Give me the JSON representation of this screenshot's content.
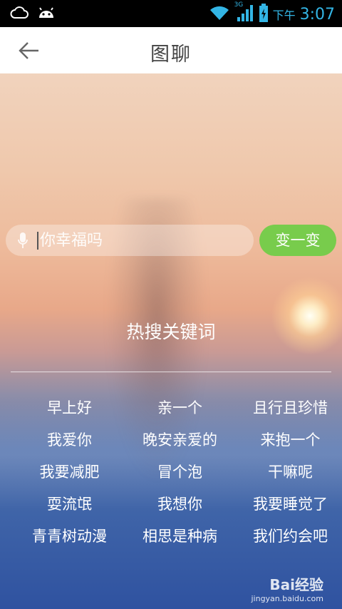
{
  "status_bar": {
    "ampm": "下午",
    "time": "3:07",
    "network_label": "3G",
    "icons": [
      "cloud-icon",
      "android-icon",
      "wifi-icon",
      "signal-icon",
      "battery-charging-icon"
    ]
  },
  "header": {
    "title": "图聊",
    "back_icon": "back-arrow-icon"
  },
  "search": {
    "placeholder": "你幸福吗",
    "value": "",
    "mic_icon": "microphone-icon",
    "shuffle_label": "变一变"
  },
  "hot_keywords": {
    "title": "热搜关键词",
    "items": [
      "早上好",
      "亲一个",
      "且行且珍惜",
      "我爱你",
      "晚安亲爱的",
      "来抱一个",
      "我要减肥",
      "冒个泡",
      "干嘛呢",
      "耍流氓",
      "我想你",
      "我要睡觉了",
      "青青树动漫",
      "相思是种病",
      "我们约会吧"
    ]
  },
  "watermark": {
    "logo": "Bai经验",
    "url": "jingyan.baidu.com"
  },
  "colors": {
    "accent_green": "#78cc4c",
    "status_blue": "#33b5e5"
  }
}
